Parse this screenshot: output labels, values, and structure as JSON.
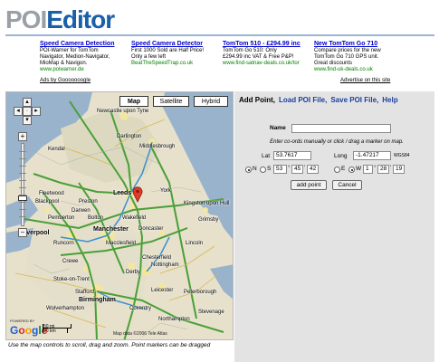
{
  "logo": {
    "part1": "POI",
    "part2": "Editor"
  },
  "ads": [
    {
      "title": "Speed Camera Detection",
      "lines": [
        "POI-Warner for TomTom",
        "Navigator, Medion-Navigator,",
        "MioMap & Navigon."
      ],
      "url": "www.poiwarner.de"
    },
    {
      "title": "Speed Camera Detector",
      "lines": [
        "First 1000 Sold are Half Price!",
        "Only a few left"
      ],
      "url": "BeatTheSpeedTrap.co.uk"
    },
    {
      "title": "TomTom 510 - £294.99 inc",
      "lines": [
        "TomTom Go 510: Only",
        "£294.99 inc VAT & Free P&P!"
      ],
      "url": "www.find-satnav-deals.co.uk/tor"
    },
    {
      "title": "New TomTom Go 710",
      "lines": [
        "Compare prices for the new",
        "TomTom Go 710 GPS unit.",
        "Great discounts"
      ],
      "url": "www.find-uk-deals.co.uk"
    }
  ],
  "ads_by": "Ads by Gooooooogle",
  "advertise": "Advertise on this site",
  "map": {
    "buttons": {
      "map": "Map",
      "satellite": "Satellite",
      "hybrid": "Hybrid"
    },
    "active": "map",
    "places": [
      {
        "name": "Newcastle upon Tyne",
        "label": "New      \nUpon Tyne"
      },
      {
        "name": "Darlington",
        "label": "Darlington"
      },
      {
        "name": "Middlesbrough",
        "label": "Middlesbrough"
      },
      {
        "name": "Fleetwood",
        "label": "Fleetwood"
      },
      {
        "name": "Blackpool",
        "label": "Blackpool"
      },
      {
        "name": "Preston",
        "label": "Preston"
      },
      {
        "name": "Leeds",
        "label": "Leeds"
      },
      {
        "name": "York",
        "label": "York"
      },
      {
        "name": "Kingston upon Hull",
        "label": "Kingston upon Hull"
      },
      {
        "name": "Pemberton",
        "label": "Pemberton"
      },
      {
        "name": "Bolton",
        "label": "Bolton"
      },
      {
        "name": "Wakefield",
        "label": "Wakefield"
      },
      {
        "name": "Grimsby",
        "label": "Grimsby"
      },
      {
        "name": "Liverpool",
        "label": "Liverpool"
      },
      {
        "name": "Manchester",
        "label": "Manchester"
      },
      {
        "name": "Doncaster",
        "label": "Doncaster"
      },
      {
        "name": "Runcorn",
        "label": "Runcorn"
      },
      {
        "name": "Macclesfield",
        "label": "Macclesfield"
      },
      {
        "name": "Chesterfield",
        "label": "Chesterfield"
      },
      {
        "name": "Lincoln",
        "label": "Lincoln"
      },
      {
        "name": "Crewe",
        "label": "Crewe"
      },
      {
        "name": "Derby",
        "label": "Derby"
      },
      {
        "name": "Nottingham",
        "label": "Nottingham"
      },
      {
        "name": "Stoke-on-Trent",
        "label": "Stoke-on-Trent"
      },
      {
        "name": "Stafford",
        "label": "Stafford"
      },
      {
        "name": "Leicester",
        "label": "Leicester"
      },
      {
        "name": "Peterborough",
        "label": "Peterborough"
      },
      {
        "name": "Birmingham",
        "label": "Birmingham"
      },
      {
        "name": "Coventry",
        "label": "Coventry"
      },
      {
        "name": "Wolverhampton",
        "label": "Wolverhampton"
      },
      {
        "name": "Northampton",
        "label": "Northampton"
      },
      {
        "name": "Stevenage",
        "label": "Stevenage"
      },
      {
        "name": "Darwen",
        "label": "Darwen"
      },
      {
        "name": "Kendal",
        "label": "Kendal"
      }
    ],
    "powered_by": "POWERED BY",
    "google": [
      "G",
      "o",
      "o",
      "g",
      "l",
      "e"
    ],
    "scale_mi": "50 mi",
    "scale_km": "50 km",
    "copyright": "Map data ©2006 Tele Atlas"
  },
  "caption": "Use the map controls to scroll, drag and zoom. Point markers can be dragged",
  "panel": {
    "nav": {
      "add_point": "Add Point,",
      "load": "Load POI File,",
      "save": "Save POI File,",
      "help": "Help"
    },
    "name_label": "Name",
    "name_value": "",
    "hint": "Enter co-ords manually or click / drag a marker on map.",
    "lat_label": "Lat",
    "lat_value": "53.7617",
    "long_label": "Long",
    "long_value": "-1.47217",
    "wgs": "WGS84",
    "n": "N",
    "s": "S",
    "e": "E",
    "w": "W",
    "lat_deg": "53",
    "lat_min": "45",
    "lat_sec": "42",
    "lon_deg": "1",
    "lon_min": "28",
    "lon_sec": "19",
    "lat_dir": "N",
    "lon_dir": "W",
    "add_btn": "add point",
    "cancel_btn": "Cancel"
  }
}
